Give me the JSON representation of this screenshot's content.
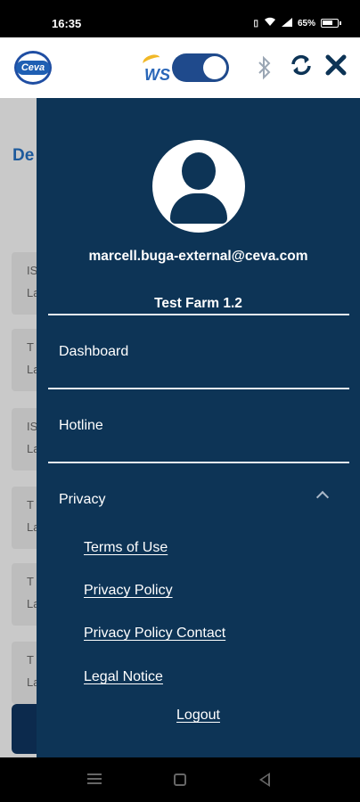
{
  "status_bar": {
    "time": "16:35",
    "battery_label": "65%"
  },
  "header": {
    "logo_text": "Ceva",
    "ws_label": "WS",
    "toggle_state": "on",
    "icons": [
      "bluetooth-icon",
      "sync-icon",
      "close-icon"
    ]
  },
  "background": {
    "title_partial": "De",
    "cards": [
      {
        "line1": "IS",
        "line2": "La"
      },
      {
        "line1": "T",
        "line2": "La"
      },
      {
        "line1": "IS",
        "line2": "La"
      },
      {
        "line1": "T",
        "line2": "La"
      },
      {
        "line1": "T",
        "line2": "La"
      },
      {
        "line1": "T",
        "line2": "La"
      }
    ]
  },
  "drawer": {
    "email": "marcell.buga-external@ceva.com",
    "farm": "Test Farm 1.2",
    "menu": {
      "dashboard": "Dashboard",
      "hotline": "Hotline",
      "privacy": "Privacy"
    },
    "privacy_links": {
      "terms": "Terms of Use",
      "policy": "Privacy Policy",
      "contact": "Privacy Policy Contact",
      "legal": "Legal Notice"
    },
    "logout": "Logout"
  },
  "colors": {
    "drawer_bg": "#0d3456",
    "accent": "#1f4a8c",
    "header_bg": "#ffffff"
  }
}
